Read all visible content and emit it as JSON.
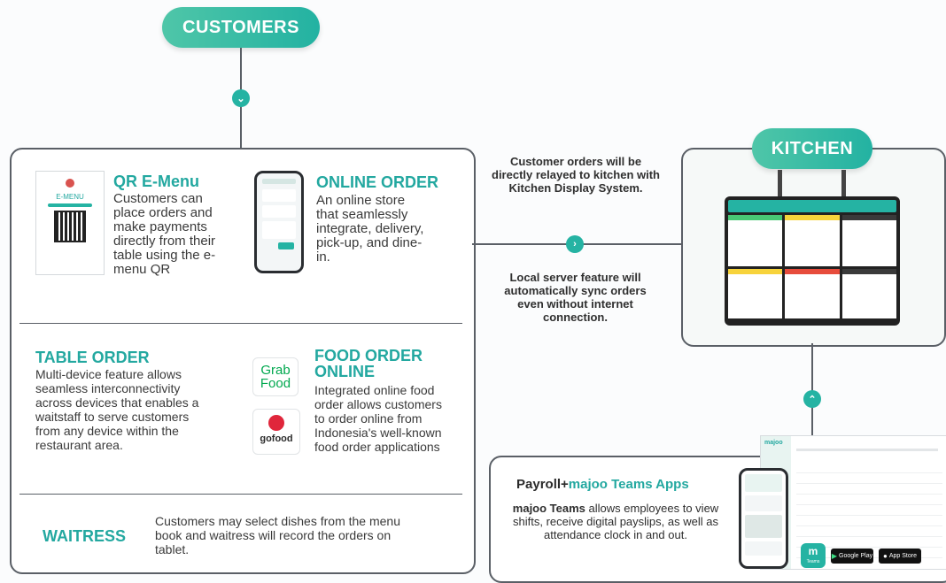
{
  "customers": {
    "label": "CUSTOMERS"
  },
  "kitchen": {
    "label": "KITCHEN"
  },
  "qr_emenu": {
    "title": "QR E-Menu",
    "desc": "Customers can place orders and make payments directly from their table using the e-menu QR",
    "card_label": "E-MENU"
  },
  "online_order": {
    "title": "ONLINE ORDER",
    "desc": "An online store that seamlessly integrate, delivery, pick-up, and dine-in."
  },
  "table_order": {
    "title": "TABLE ORDER",
    "desc": "Multi-device feature allows seamless interconnectivity across devices that enables a waitstaff to serve customers from any device within the restaurant area."
  },
  "food_order": {
    "title_line1": "FOOD ORDER",
    "title_line2": "ONLINE",
    "desc": "Integrated online food order allows customers to order online from Indonesia's well-known food order applications",
    "grab_line1": "Grab",
    "grab_line2": "Food",
    "gofood": "gofood"
  },
  "waitress": {
    "title": "WAITRESS",
    "desc": "Customers may select dishes from the menu book and waitress will record the orders on tablet."
  },
  "middle": {
    "text1": "Customer orders will be directly relayed to kitchen with Kitchen Display System.",
    "text2": "Local server feature will automatically sync orders even without internet connection."
  },
  "payroll": {
    "title_part1": "Payroll+",
    "title_part2": "majoo Teams Apps",
    "desc_bold": "majoo Teams",
    "desc_rest": " allows employees to view shifts, receive digital payslips, as well as attendance clock in and out.",
    "google_play": "Google Play",
    "app_store": "App Store",
    "teams_label": "Teams",
    "dashboard_brand": "majoo"
  },
  "colors": {
    "teal": "#25b3a3",
    "line": "#5a5f66",
    "text": "#3a3a3a"
  },
  "icons": {
    "down": "chevron-down-icon",
    "right": "chevron-right-icon",
    "up": "chevron-up-icon"
  }
}
